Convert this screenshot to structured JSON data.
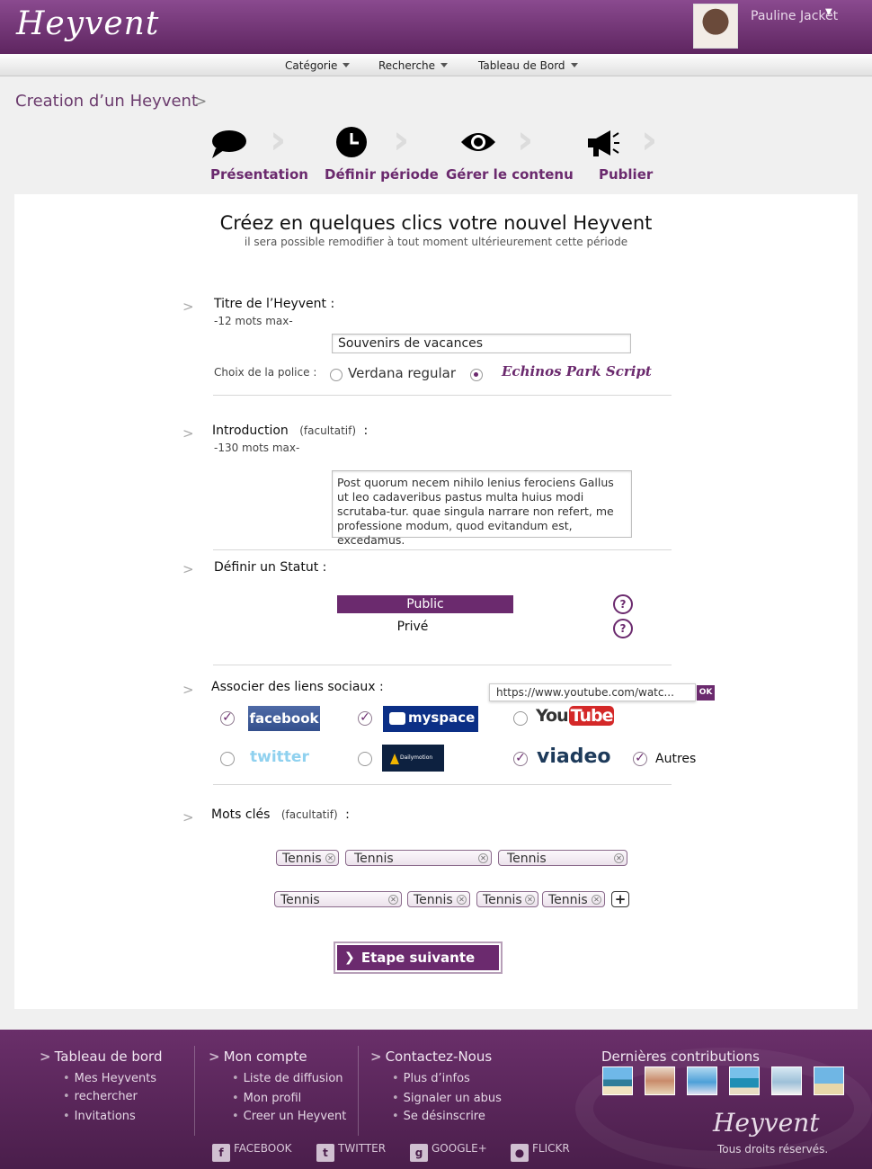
{
  "header": {
    "logo": "Heyvent",
    "user_name": "Pauline Jacket",
    "nav": [
      "Catégorie",
      "Recherche",
      "Tableau de Bord"
    ]
  },
  "breadcrumb": "Creation d’un Heyvent",
  "steps": [
    "Présentation",
    "Définir période",
    "Gérer le contenu",
    "Publier"
  ],
  "form": {
    "title": "Créez en quelques clics votre nouvel Heyvent",
    "subtitle": "il sera possible remodifier à tout moment ultérieurement cette période",
    "event_title": {
      "label": "Titre de l’Heyvent :",
      "note": "-12 mots max-",
      "value": "Souvenirs de vacances",
      "font_label": "Choix de la police :",
      "font_option_1": "Verdana regular",
      "font_option_2": "Echinos Park Script",
      "selected_font": "Echinos Park Script"
    },
    "intro": {
      "label": "Introduction",
      "optional": "(facultatif)",
      "colon": ":",
      "note": "-130 mots max-",
      "value": "Post quorum necem nihilo lenius ferociens Gallus ut leo cadaveribus pastus multa huius modi scrutaba-tur. quae singula narrare non refert, me professione modum, quod evitandum est, excedamus."
    },
    "status": {
      "label": "Définir un Statut :",
      "public": "Public",
      "private": "Privé",
      "selected": "Public",
      "help": "?"
    },
    "social": {
      "label": "Associer des liens sociaux :",
      "url_value": "https://www.youtube.com/watc...",
      "ok": "OK",
      "facebook": "facebook",
      "myspace": "myspace",
      "youtube_1": "You",
      "youtube_2": "Tube",
      "twitter": "twitter",
      "dailymotion": "Dailymotion",
      "viadeo": "viadeo",
      "others": "Autres",
      "checked": [
        "facebook",
        "myspace",
        "viadeo",
        "Autres"
      ]
    },
    "keywords": {
      "label": "Mots clés",
      "optional": "(facultatif)",
      "colon": ":",
      "tags": [
        "Tennis",
        "Tennis",
        "Tennis",
        "Tennis",
        "Tennis",
        "Tennis",
        "Tennis"
      ],
      "add": "+"
    },
    "next": "Etape suivante"
  },
  "footer": {
    "col1": {
      "title": "Tableau de bord",
      "items": [
        "Mes Heyvents",
        "rechercher",
        "Invitations"
      ]
    },
    "col2": {
      "title": "Mon compte",
      "items": [
        "Liste de diffusion",
        "Mon profil",
        "Creer un Heyvent"
      ]
    },
    "col3": {
      "title": "Contactez-Nous",
      "items": [
        "Plus d’infos",
        "Signaler un abus",
        "Se désinscrire"
      ]
    },
    "contributions": "Dernières contributions",
    "social": [
      "FACEBOOK",
      "TWITTER",
      "GOOGLE+",
      "FLICKR"
    ],
    "logo": "Heyvent",
    "rights": "Tous droits réservés."
  },
  "colors": {
    "brand": "#6b2a6e",
    "header": "#7a3a7e",
    "footer": "#5a255b"
  }
}
